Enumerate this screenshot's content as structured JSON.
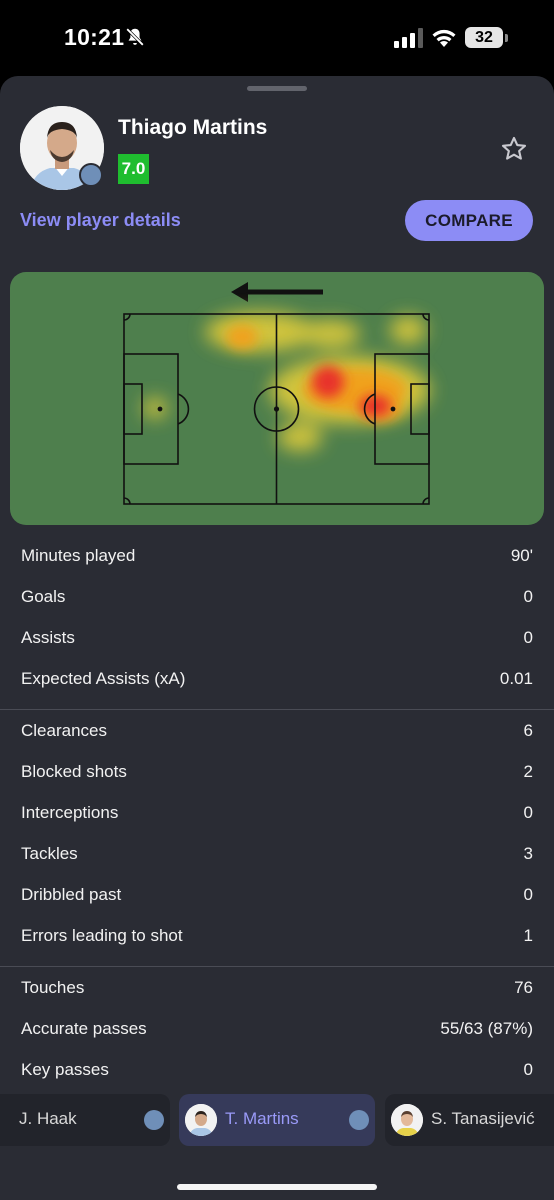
{
  "status_bar": {
    "time": "10:21",
    "battery": "32"
  },
  "player": {
    "name": "Thiago Martins",
    "rating": "7.0",
    "details_link": "View player details",
    "compare_label": "COMPARE"
  },
  "heatmap": {
    "attack_direction": "left"
  },
  "stats_groups": [
    [
      {
        "label": "Minutes played",
        "value": "90'"
      },
      {
        "label": "Goals",
        "value": "0"
      },
      {
        "label": "Assists",
        "value": "0"
      },
      {
        "label": "Expected Assists (xA)",
        "value": "0.01"
      }
    ],
    [
      {
        "label": "Clearances",
        "value": "6"
      },
      {
        "label": "Blocked shots",
        "value": "2"
      },
      {
        "label": "Interceptions",
        "value": "0"
      },
      {
        "label": "Tackles",
        "value": "3"
      },
      {
        "label": "Dribbled past",
        "value": "0"
      },
      {
        "label": "Errors leading to shot",
        "value": "1"
      }
    ],
    [
      {
        "label": "Touches",
        "value": "76"
      },
      {
        "label": "Accurate passes",
        "value": "55/63 (87%)"
      },
      {
        "label": "Key passes",
        "value": "0"
      }
    ]
  ],
  "switcher": [
    {
      "name": "J. Haak",
      "active": false
    },
    {
      "name": "T. Martins",
      "active": true
    },
    {
      "name": "S. Tanasijević",
      "active": false
    }
  ],
  "colors": {
    "accent": "#8c8cf5",
    "rating_green": "#1fbd2f",
    "pitch": "#4e7f4d",
    "sheet": "#2a2c34"
  }
}
